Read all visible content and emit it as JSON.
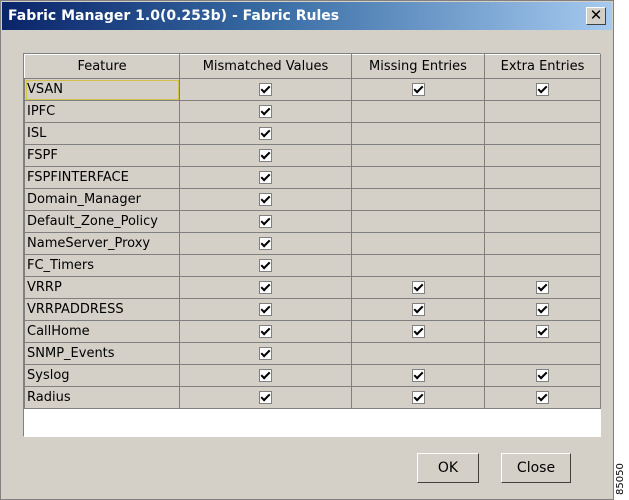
{
  "window": {
    "title": "Fabric Manager 1.0(0.253b) - Fabric Rules",
    "close_glyph": "✕"
  },
  "table": {
    "columns": [
      "Feature",
      "Mismatched Values",
      "Missing Entries",
      "Extra Entries"
    ],
    "rows": [
      {
        "feature": "VSAN",
        "mismatched": true,
        "missing": true,
        "extra": true
      },
      {
        "feature": "IPFC",
        "mismatched": true,
        "missing": false,
        "extra": false
      },
      {
        "feature": "ISL",
        "mismatched": true,
        "missing": false,
        "extra": false
      },
      {
        "feature": "FSPF",
        "mismatched": true,
        "missing": false,
        "extra": false
      },
      {
        "feature": "FSPFINTERFACE",
        "mismatched": true,
        "missing": false,
        "extra": false
      },
      {
        "feature": "Domain_Manager",
        "mismatched": true,
        "missing": false,
        "extra": false
      },
      {
        "feature": "Default_Zone_Policy",
        "mismatched": true,
        "missing": false,
        "extra": false
      },
      {
        "feature": "NameServer_Proxy",
        "mismatched": true,
        "missing": false,
        "extra": false
      },
      {
        "feature": "FC_Timers",
        "mismatched": true,
        "missing": false,
        "extra": false
      },
      {
        "feature": "VRRP",
        "mismatched": true,
        "missing": true,
        "extra": true
      },
      {
        "feature": "VRRPADDRESS",
        "mismatched": true,
        "missing": true,
        "extra": true
      },
      {
        "feature": "CallHome",
        "mismatched": true,
        "missing": true,
        "extra": true
      },
      {
        "feature": "SNMP_Events",
        "mismatched": true,
        "missing": false,
        "extra": false
      },
      {
        "feature": "Syslog",
        "mismatched": true,
        "missing": true,
        "extra": true
      },
      {
        "feature": "Radius",
        "mismatched": true,
        "missing": true,
        "extra": true
      }
    ]
  },
  "buttons": {
    "ok": "OK",
    "close": "Close"
  },
  "side_code": "85050"
}
